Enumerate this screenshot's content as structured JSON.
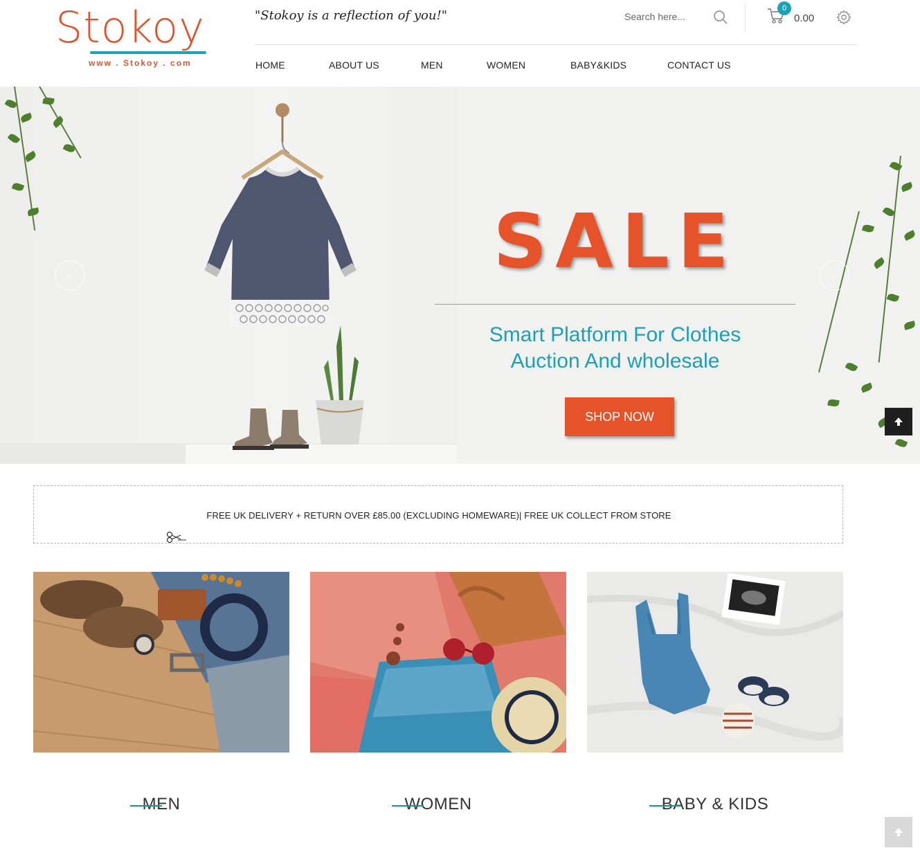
{
  "brand": {
    "logo_text": "Stokoy",
    "logo_url": "www . Stokoy . com",
    "tagline": "\"Stokoy is a reflection of you!\""
  },
  "search": {
    "placeholder": "Search here..."
  },
  "cart": {
    "count": "0",
    "total": "0.00"
  },
  "nav": {
    "items": [
      "HOME",
      "ABOUT US",
      "MEN",
      "WOMEN",
      "BABY&KIDS",
      "CONTACT US"
    ]
  },
  "hero": {
    "headline": "SALE",
    "subline_1": "Smart Platform For Clothes",
    "subline_2": "Auction And wholesale",
    "cta": "SHOP NOW",
    "prev_arrow": "‹",
    "next_arrow": "›"
  },
  "promo": {
    "text": "FREE UK DELIVERY + RETURN OVER £85.00 (EXCLUDING HOMEWARE)| FREE UK COLLECT FROM STORE"
  },
  "categories": [
    {
      "label": "MEN"
    },
    {
      "label": "WOMEN"
    },
    {
      "label": "BABY & KIDS"
    }
  ],
  "colors": {
    "brand_orange": "#e6532a",
    "brand_teal": "#1da3b6"
  },
  "icons": {
    "scroll_top": "arrow-up-icon"
  }
}
